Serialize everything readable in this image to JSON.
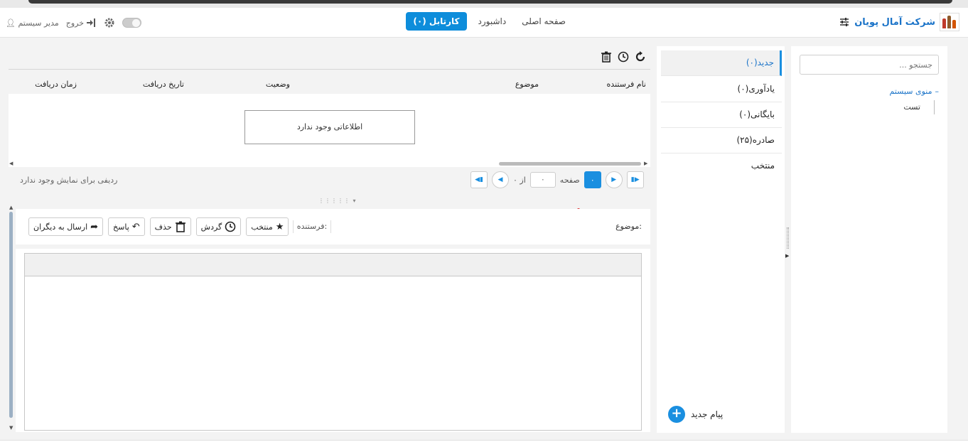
{
  "brand": {
    "name": "شرکت آمال پویان"
  },
  "nav": {
    "items": [
      "صفحه اصلی",
      "داشبورد"
    ],
    "active": "کارتابل (۰)"
  },
  "user": {
    "name": "مدیر سیستم",
    "logout": "خروج"
  },
  "sidebar": {
    "search_placeholder": "جستجو ...",
    "root_label": "منوی سیستم",
    "child_label": "تست"
  },
  "folders": [
    {
      "label": "جدید(۰)",
      "active": true
    },
    {
      "label": "یادآوری(۰)",
      "active": false
    },
    {
      "label": "بایگانی(۰)",
      "active": false
    },
    {
      "label": "صادره(۲۵)",
      "active": false
    },
    {
      "label": "منتخب",
      "active": false
    }
  ],
  "new_message": {
    "label": "پیام جدید",
    "icon": "plus-icon"
  },
  "table": {
    "columns": [
      "نام فرستنده",
      "موضوع",
      "وضعیت",
      "تاریخ دریافت",
      "زمان دریافت"
    ],
    "empty_message": "اطلاعاتی وجود ندارد"
  },
  "pager": {
    "page_label": "صفحه",
    "of_label": "از ۰",
    "current_page": "۰",
    "input_value": "۰",
    "no_rows": "ردیفی برای نمایش وجود ندارد"
  },
  "detail": {
    "subject_label": "موضوع:",
    "sender_label": "فرستنده:",
    "actions": {
      "favorite": "منتخب",
      "route": "گردش",
      "delete": "حذف",
      "reply": "پاسخ",
      "forward": "ارسال به دیگران"
    }
  },
  "colors": {
    "accent": "#1a8fe0",
    "brand": "#1a73c8"
  }
}
